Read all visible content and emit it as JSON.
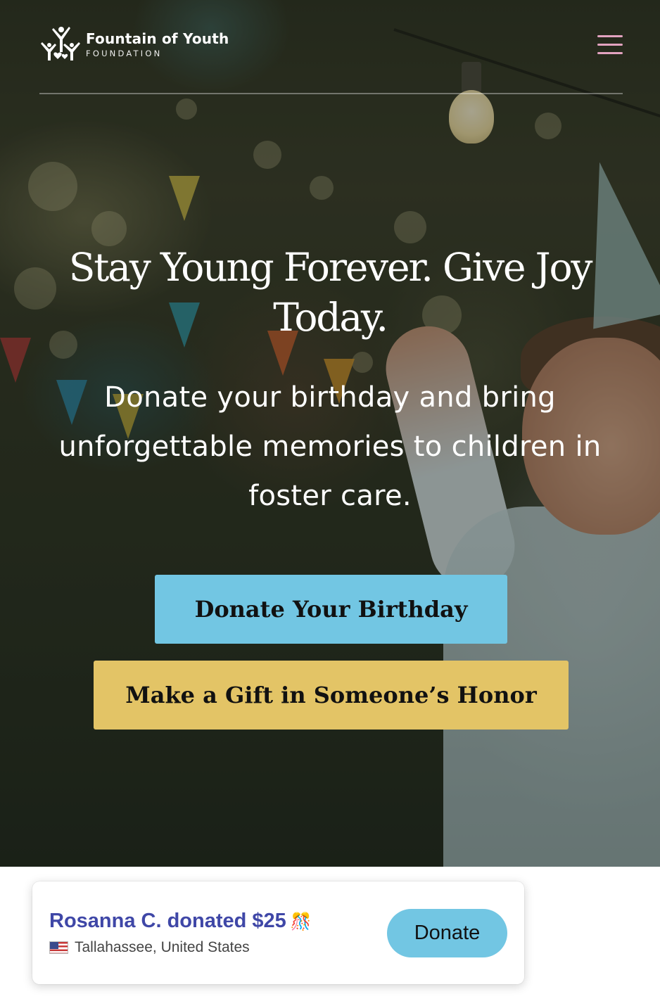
{
  "brand": {
    "name": "Fountain of Youth",
    "subtitle": "FOUNDATION",
    "logo_icon": "fountain-figures-logo"
  },
  "header": {
    "menu_icon": "hamburger-menu-icon",
    "menu_color": "#e3a3c0"
  },
  "hero": {
    "headline": "Stay Young Forever. Give Joy Today.",
    "subheadline": "Donate your birthday and bring unforgettable memories to children in foster care.",
    "primary_button": "Donate Your Birthday",
    "secondary_button": "Make a Gift in Someone’s Honor",
    "primary_color": "#72c6e3",
    "secondary_color": "#e3c466"
  },
  "donation_toast": {
    "message": "Rosanna C. donated $25",
    "emoji": "🎊",
    "location": "Tallahassee, United States",
    "flag_icon": "us-flag-icon",
    "button": "Donate",
    "message_color": "#3f47a7"
  }
}
